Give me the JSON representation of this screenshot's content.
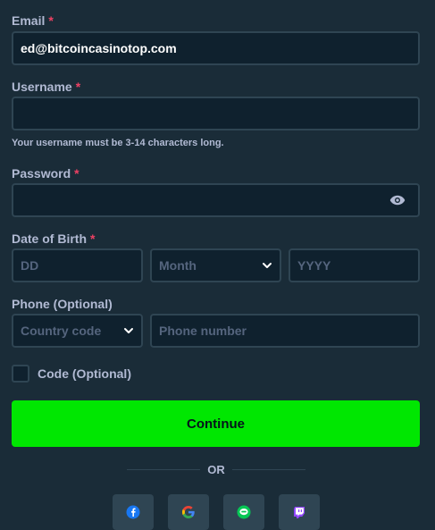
{
  "email": {
    "label": "Email",
    "required": "*",
    "value": "ed@bitcoincasinotop.com"
  },
  "username": {
    "label": "Username",
    "required": "*",
    "value": "",
    "hint": "Your username must be 3-14 characters long."
  },
  "password": {
    "label": "Password",
    "required": "*",
    "value": "",
    "toggle_icon": "eye-icon"
  },
  "dob": {
    "label": "Date of Birth",
    "required": "*",
    "day_placeholder": "DD",
    "month_placeholder": "Month",
    "year_placeholder": "YYYY"
  },
  "phone": {
    "label": "Phone (Optional)",
    "country_placeholder": "Country code",
    "number_placeholder": "Phone number"
  },
  "code": {
    "label": "Code (Optional)",
    "checked": false
  },
  "continue_label": "Continue",
  "or_label": "OR",
  "social": [
    {
      "name": "facebook",
      "icon": "facebook-icon",
      "color": "#1877f2"
    },
    {
      "name": "google",
      "icon": "google-icon",
      "color": "#4285f4"
    },
    {
      "name": "line",
      "icon": "line-icon",
      "color": "#06c755"
    },
    {
      "name": "twitch",
      "icon": "twitch-icon",
      "color": "#9146ff"
    }
  ],
  "colors": {
    "background": "#1a2c38",
    "input_bg": "#0f212e",
    "border": "#2f4553",
    "accent": "#00e701",
    "required": "#ed4163"
  }
}
